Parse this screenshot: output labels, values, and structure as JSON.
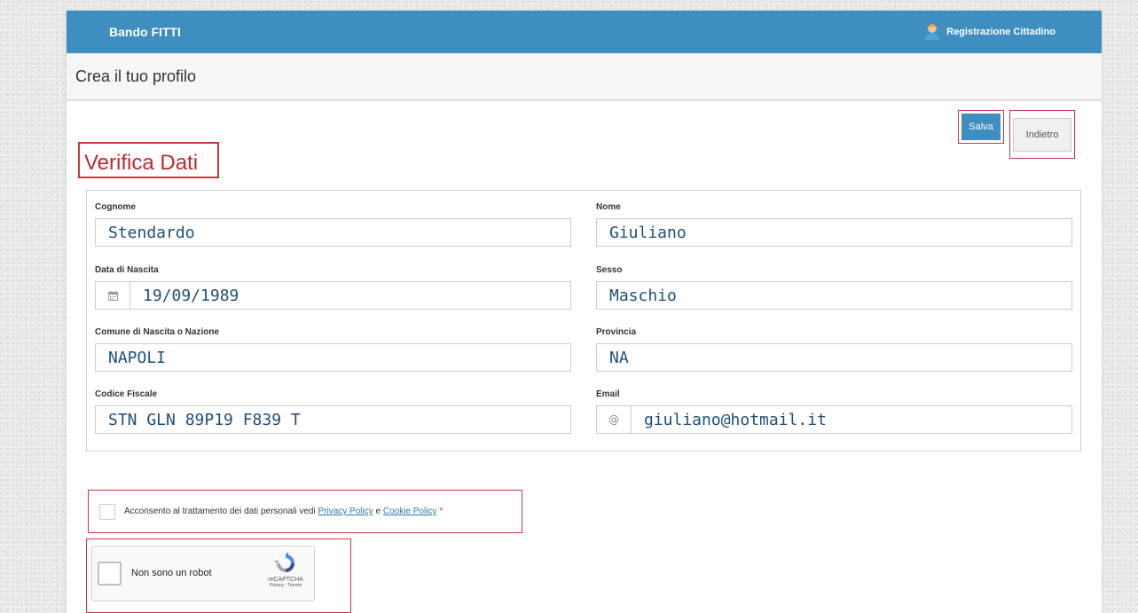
{
  "header": {
    "brand": "Bando FITTI",
    "user_label": "Registrazione Cittadino"
  },
  "subheader": {
    "title": "Crea il tuo profilo"
  },
  "toolbar": {
    "save_label": "Salva",
    "back_label": "Indietro"
  },
  "section": {
    "title": "Verifica Dati"
  },
  "fields": {
    "cognome": {
      "label": "Cognome",
      "value": "Stendardo"
    },
    "nome": {
      "label": "Nome",
      "value": "Giuliano"
    },
    "data_nascita": {
      "label": "Data di Nascita",
      "value": "19/09/1989",
      "icon": "calendar-icon"
    },
    "sesso": {
      "label": "Sesso",
      "value": "Maschio"
    },
    "comune": {
      "label": "Comune di Nascita o Nazione",
      "value": "NAPOLI"
    },
    "provincia": {
      "label": "Provincia",
      "value": "NA"
    },
    "codice_fiscale": {
      "label": "Codice Fiscale",
      "value": "STN GLN 89P19 F839 T"
    },
    "email": {
      "label": "Email",
      "value": "giuliano@hotmail.it",
      "icon": "at-icon"
    }
  },
  "consent": {
    "text": "Acconsento al trattamento dei dati personali vedi",
    "privacy_link": "Privacy Policy",
    "conjunction": "e",
    "cookie_link": "Cookie Policy",
    "required_mark": "*"
  },
  "captcha": {
    "label": "Non sono un robot",
    "brand": "reCAPTCHA",
    "terms": "Privacy - Termini"
  },
  "colors": {
    "header_bg": "#3e8ebf",
    "accent_red": "#c9383d",
    "value_text": "#1f4e79"
  }
}
